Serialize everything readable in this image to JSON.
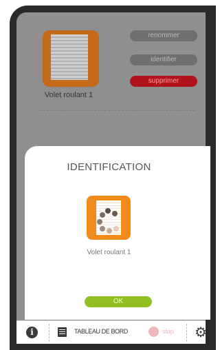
{
  "background": {
    "product_name": "Volet roulant 1",
    "actions": {
      "rename": "renommer",
      "identify": "identifier",
      "delete": "supprimer"
    }
  },
  "modal": {
    "title": "IDENTIFICATION",
    "product_name": "Volet roulant 1",
    "ok_label": "OK"
  },
  "bottom_bar": {
    "info_icon": "info-icon",
    "dashboard_label": "TABLEAU DE BORD",
    "stop_label": "stop",
    "settings_icon": "gear-icon"
  },
  "colors": {
    "accent_orange": "#f08a1a",
    "danger_red": "#b0131b",
    "ok_green": "#8fbf20",
    "stop_pink": "#f0b8bc"
  }
}
